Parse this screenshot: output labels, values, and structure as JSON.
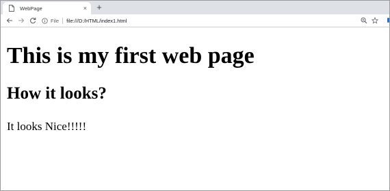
{
  "tab": {
    "title": "WebPage",
    "close_glyph": "×",
    "favicon": "page-icon"
  },
  "new_tab_glyph": "+",
  "toolbar": {
    "back_icon": "back-arrow-icon",
    "forward_icon": "forward-arrow-icon",
    "reload_icon": "reload-icon",
    "info_icon": "info-icon",
    "scheme_label": "File",
    "url": "file:///D:/HTML/index1.html",
    "zoom_icon": "zoom-icon",
    "bookmark_icon": "star-icon"
  },
  "page": {
    "heading1": "This is my first web page",
    "heading2": "How it looks?",
    "paragraph": "It looks Nice!!!!!"
  },
  "colors": {
    "tabstrip_bg": "#dee1e6",
    "accent": "#1a73e8"
  }
}
